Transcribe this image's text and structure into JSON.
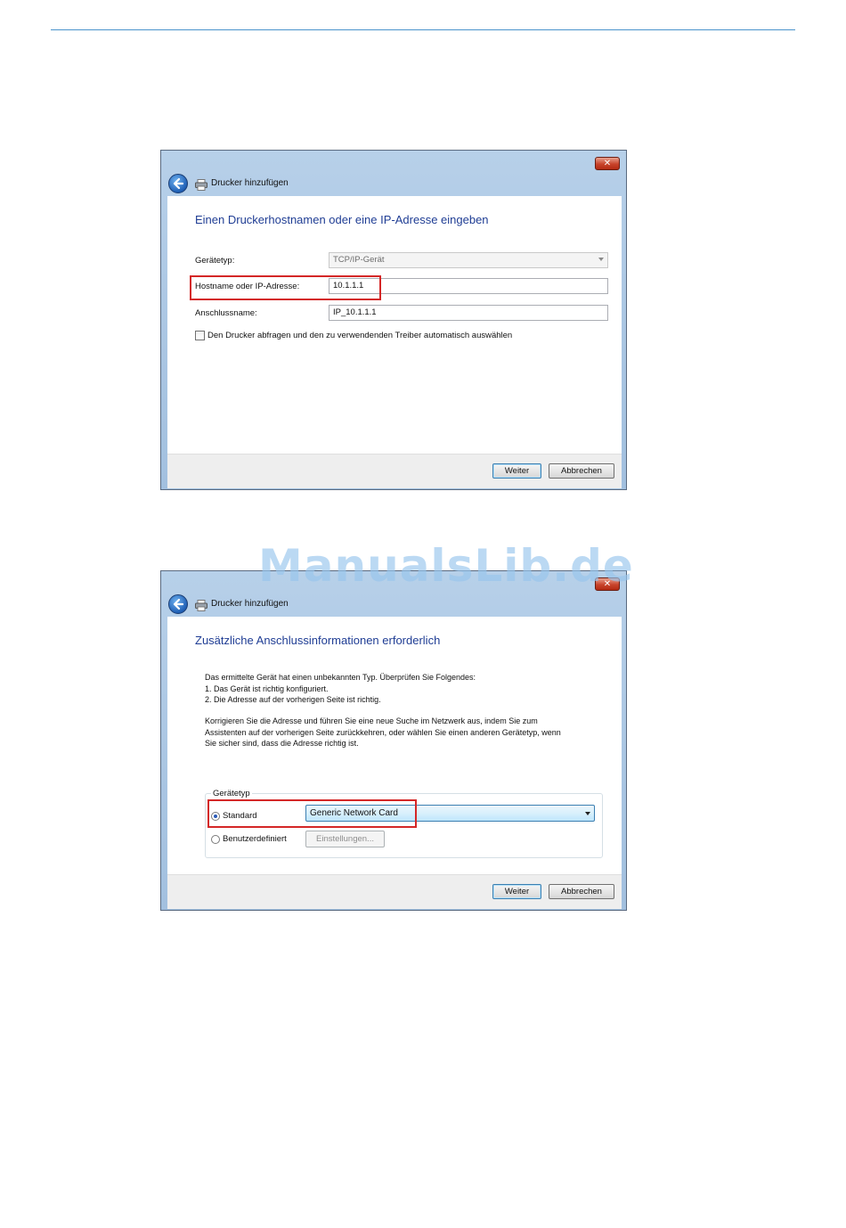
{
  "watermark": "ManualsLib.de",
  "dialog1": {
    "title": "Drucker hinzufügen",
    "close_glyph": "✕",
    "heading": "Einen Druckerhostnamen oder eine IP-Adresse eingeben",
    "device_type_label": "Gerätetyp:",
    "device_type_value": "TCP/IP-Gerät",
    "hostname_label": "Hostname oder IP-Adresse:",
    "hostname_value": "10.1.1.1",
    "port_name_label": "Anschlussname:",
    "port_name_value": "IP_10.1.1.1",
    "auto_driver_checkbox_label": "Den Drucker abfragen und den zu verwendenden Treiber automatisch auswählen",
    "auto_driver_checked": false,
    "next_button": "Weiter",
    "cancel_button": "Abbrechen"
  },
  "dialog2": {
    "title": "Drucker hinzufügen",
    "close_glyph": "✕",
    "heading": "Zusätzliche Anschlussinformationen erforderlich",
    "para1_line1": "Das ermittelte Gerät hat einen unbekannten Typ. Überprüfen Sie Folgendes:",
    "para1_line2": "1. Das Gerät ist richtig konfiguriert.",
    "para1_line3": "2. Die Adresse auf der vorherigen Seite ist richtig.",
    "para2_line1": "Korrigieren Sie die Adresse und führen Sie eine neue Suche im Netzwerk aus, indem Sie zum",
    "para2_line2": "Assistenten auf der vorherigen Seite zurückkehren, oder wählen Sie einen anderen Gerätetyp, wenn",
    "para2_line3": "Sie sicher sind, dass die Adresse richtig ist.",
    "group_title": "Gerätetyp",
    "standard_label": "Standard",
    "standard_selected": true,
    "standard_value": "Generic Network Card",
    "custom_label": "Benutzerdefiniert",
    "settings_button": "Einstellungen...",
    "next_button": "Weiter",
    "cancel_button": "Abbrechen"
  },
  "colors": {
    "heading_blue": "#1f3d94",
    "highlight_red": "#d42727",
    "frame_blue": "#a9c5e2"
  }
}
